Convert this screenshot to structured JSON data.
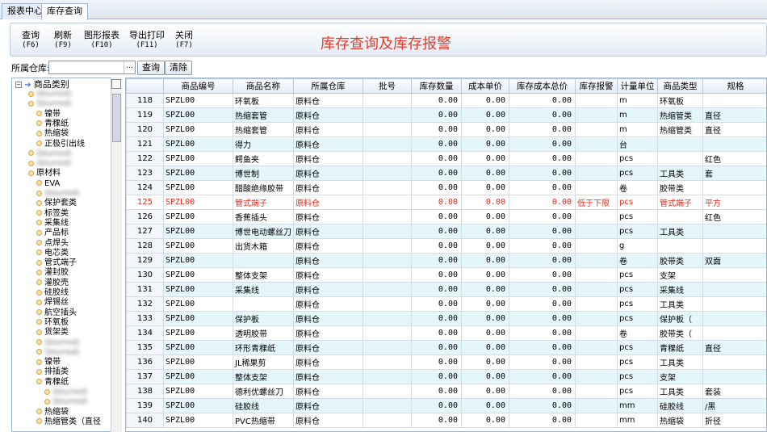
{
  "tabs": [
    {
      "label": "报表中心",
      "active": false
    },
    {
      "label": "库存查询",
      "active": true
    }
  ],
  "toolbar": [
    {
      "label": "查询",
      "key": "(F6)"
    },
    {
      "label": "刷新",
      "key": "(F9)"
    },
    {
      "label": "图形报表",
      "key": "(F10)"
    },
    {
      "label": "导出打印",
      "key": "(F11)"
    },
    {
      "label": "关闭",
      "key": "(F7)"
    }
  ],
  "heading": "库存查询及库存报警",
  "filter": {
    "label": "所属仓库:",
    "value": "",
    "dots": "...",
    "query_btn": "查询",
    "clear_btn": "清除"
  },
  "tree": {
    "root": "商品类别",
    "items": [
      {
        "label": "(blurred)",
        "level": 1,
        "blur": true
      },
      {
        "label": "(blurred)",
        "level": 1,
        "blur": true
      },
      {
        "label": "镍带",
        "level": 2
      },
      {
        "label": "青稞纸",
        "level": 2
      },
      {
        "label": "热缩袋",
        "level": 2
      },
      {
        "label": "正极引出线",
        "level": 2
      },
      {
        "label": "(blurred)",
        "level": 1,
        "blur": true
      },
      {
        "label": "(blurred)",
        "level": 1,
        "blur": true
      },
      {
        "label": "原材料",
        "level": 1
      },
      {
        "label": "EVA",
        "level": 2
      },
      {
        "label": "(blurred)",
        "level": 2,
        "blur": true
      },
      {
        "label": "保护套类",
        "level": 2
      },
      {
        "label": "标签类",
        "level": 2
      },
      {
        "label": "采集线",
        "level": 2
      },
      {
        "label": "产品标",
        "level": 2
      },
      {
        "label": "点焊头",
        "level": 2
      },
      {
        "label": "电芯类",
        "level": 2
      },
      {
        "label": "管式端子",
        "level": 2
      },
      {
        "label": "灌封胶",
        "level": 2
      },
      {
        "label": "灌胶壳",
        "level": 2
      },
      {
        "label": "硅胶线",
        "level": 2
      },
      {
        "label": "焊锡丝",
        "level": 2
      },
      {
        "label": "航空插头",
        "level": 2
      },
      {
        "label": "环氧板",
        "level": 2
      },
      {
        "label": "货架类",
        "level": 2
      },
      {
        "label": "(blurred)",
        "level": 2,
        "blur": true
      },
      {
        "label": "(blurred)",
        "level": 2,
        "blur": true
      },
      {
        "label": "镍带",
        "level": 2
      },
      {
        "label": "排插类",
        "level": 2
      },
      {
        "label": "青稞纸",
        "level": 2
      },
      {
        "label": "(blurred)",
        "level": 3,
        "blur": true
      },
      {
        "label": "(blurred)",
        "level": 3,
        "blur": true
      },
      {
        "label": "热缩袋",
        "level": 2
      },
      {
        "label": "热缩管类（直径",
        "level": 2
      }
    ]
  },
  "columns": [
    "",
    "商品编号",
    "商品名称",
    "所属仓库",
    "批号",
    "库存数量",
    "成本单价",
    "库存成本总价",
    "库存报警",
    "计量单位",
    "商品类型",
    "规格"
  ],
  "rows": [
    {
      "n": "118",
      "code": "SPZL00",
      "name": "环氧板",
      "wh": "原料仓",
      "qty": "0.00",
      "price": "0.00",
      "total": "0.00",
      "alarm": "",
      "unit": "m",
      "type": "环氧板",
      "spec": ""
    },
    {
      "n": "119",
      "code": "SPZL00",
      "name": "热缩套管",
      "wh": "原料仓",
      "qty": "0.00",
      "price": "0.00",
      "total": "0.00",
      "alarm": "",
      "unit": "m",
      "type": "热缩管类",
      "spec": "直径"
    },
    {
      "n": "120",
      "code": "SPZL00",
      "name": "热缩套管",
      "wh": "原料仓",
      "qty": "0.00",
      "price": "0.00",
      "total": "0.00",
      "alarm": "",
      "unit": "m",
      "type": "热缩管类",
      "spec": "直径"
    },
    {
      "n": "121",
      "code": "SPZL00",
      "name": "得力",
      "wh": "原料仓",
      "qty": "0.00",
      "price": "0.00",
      "total": "0.00",
      "alarm": "",
      "unit": "台",
      "type": "",
      "spec": ""
    },
    {
      "n": "122",
      "code": "SPZL00",
      "name": "鳄鱼夹",
      "wh": "原料仓",
      "qty": "0.00",
      "price": "0.00",
      "total": "0.00",
      "alarm": "",
      "unit": "pcs",
      "type": "",
      "spec": "红色"
    },
    {
      "n": "123",
      "code": "SPZL00",
      "name": "博世制",
      "wh": "原料仓",
      "qty": "0.00",
      "price": "0.00",
      "total": "0.00",
      "alarm": "",
      "unit": "pcs",
      "type": "工具类",
      "spec": "套"
    },
    {
      "n": "124",
      "code": "SPZL00",
      "name": "醋酸绝缘胶带",
      "wh": "原料仓",
      "qty": "0.00",
      "price": "0.00",
      "total": "0.00",
      "alarm": "",
      "unit": "卷",
      "type": "胶带类",
      "spec": ""
    },
    {
      "n": "125",
      "code": "SPZL00",
      "name": "管式端子",
      "wh": "原料仓",
      "qty": "0.00",
      "price": "0.00",
      "total": "0.00",
      "alarm": "低于下限",
      "unit": "pcs",
      "type": "管式端子",
      "spec": "平方",
      "alert": true
    },
    {
      "n": "126",
      "code": "SPZL00",
      "name": "香蕉插头",
      "wh": "原料仓",
      "qty": "0.00",
      "price": "0.00",
      "total": "0.00",
      "alarm": "",
      "unit": "pcs",
      "type": "",
      "spec": "红色"
    },
    {
      "n": "127",
      "code": "SPZL00",
      "name": "博世电动螺丝刀",
      "wh": "原料仓",
      "qty": "0.00",
      "price": "0.00",
      "total": "0.00",
      "alarm": "",
      "unit": "pcs",
      "type": "工具类",
      "spec": ""
    },
    {
      "n": "128",
      "code": "SPZL00",
      "name": "出货木箱",
      "wh": "原料仓",
      "qty": "0.00",
      "price": "0.00",
      "total": "0.00",
      "alarm": "",
      "unit": "g",
      "type": "",
      "spec": ""
    },
    {
      "n": "129",
      "code": "SPZL00",
      "name": "",
      "wh": "原料仓",
      "qty": "0.00",
      "price": "0.00",
      "total": "0.00",
      "alarm": "",
      "unit": "卷",
      "type": "胶带类",
      "spec": "双面"
    },
    {
      "n": "130",
      "code": "SPZL00",
      "name": "整体支架",
      "wh": "原料仓",
      "qty": "0.00",
      "price": "0.00",
      "total": "0.00",
      "alarm": "",
      "unit": "pcs",
      "type": "支架",
      "spec": ""
    },
    {
      "n": "131",
      "code": "SPZL00",
      "name": "采集线",
      "wh": "原料仓",
      "qty": "0.00",
      "price": "0.00",
      "total": "0.00",
      "alarm": "",
      "unit": "pcs",
      "type": "采集线",
      "spec": ""
    },
    {
      "n": "132",
      "code": "SPZL00",
      "name": "",
      "wh": "原料仓",
      "qty": "0.00",
      "price": "0.00",
      "total": "0.00",
      "alarm": "",
      "unit": "pcs",
      "type": "工具类",
      "spec": ""
    },
    {
      "n": "133",
      "code": "SPZL00",
      "name": "保护板",
      "wh": "原料仓",
      "qty": "0.00",
      "price": "0.00",
      "total": "0.00",
      "alarm": "",
      "unit": "pcs",
      "type": "保护板（",
      "spec": ""
    },
    {
      "n": "134",
      "code": "SPZL00",
      "name": "透明胶带",
      "wh": "原料仓",
      "qty": "0.00",
      "price": "0.00",
      "total": "0.00",
      "alarm": "",
      "unit": "卷",
      "type": "胶带类（",
      "spec": ""
    },
    {
      "n": "135",
      "code": "SPZL00",
      "name": "环形青稞纸",
      "wh": "原料仓",
      "qty": "0.00",
      "price": "0.00",
      "total": "0.00",
      "alarm": "",
      "unit": "pcs",
      "type": "青稞纸",
      "spec": "直径"
    },
    {
      "n": "136",
      "code": "SPZL00",
      "name": "JL稀果剪",
      "wh": "原料仓",
      "qty": "0.00",
      "price": "0.00",
      "total": "0.00",
      "alarm": "",
      "unit": "pcs",
      "type": "工具类",
      "spec": ""
    },
    {
      "n": "137",
      "code": "SPZL00",
      "name": "整体支架",
      "wh": "原料仓",
      "qty": "0.00",
      "price": "0.00",
      "total": "0.00",
      "alarm": "",
      "unit": "pcs",
      "type": "支架",
      "spec": ""
    },
    {
      "n": "138",
      "code": "SPZL00",
      "name": "德利优螺丝刀",
      "wh": "原料仓",
      "qty": "0.00",
      "price": "0.00",
      "total": "0.00",
      "alarm": "",
      "unit": "pcs",
      "type": "工具类",
      "spec": "套装"
    },
    {
      "n": "139",
      "code": "SPZL00",
      "name": "硅胶线",
      "wh": "原料仓",
      "qty": "0.00",
      "price": "0.00",
      "total": "0.00",
      "alarm": "",
      "unit": "mm",
      "type": "硅胶线",
      "spec": "/黑"
    },
    {
      "n": "140",
      "code": "SPZL00",
      "name": "PVC热缩带",
      "wh": "原料仓",
      "qty": "0.00",
      "price": "0.00",
      "total": "0.00",
      "alarm": "",
      "unit": "mm",
      "type": "热缩袋",
      "spec": "折径"
    }
  ]
}
